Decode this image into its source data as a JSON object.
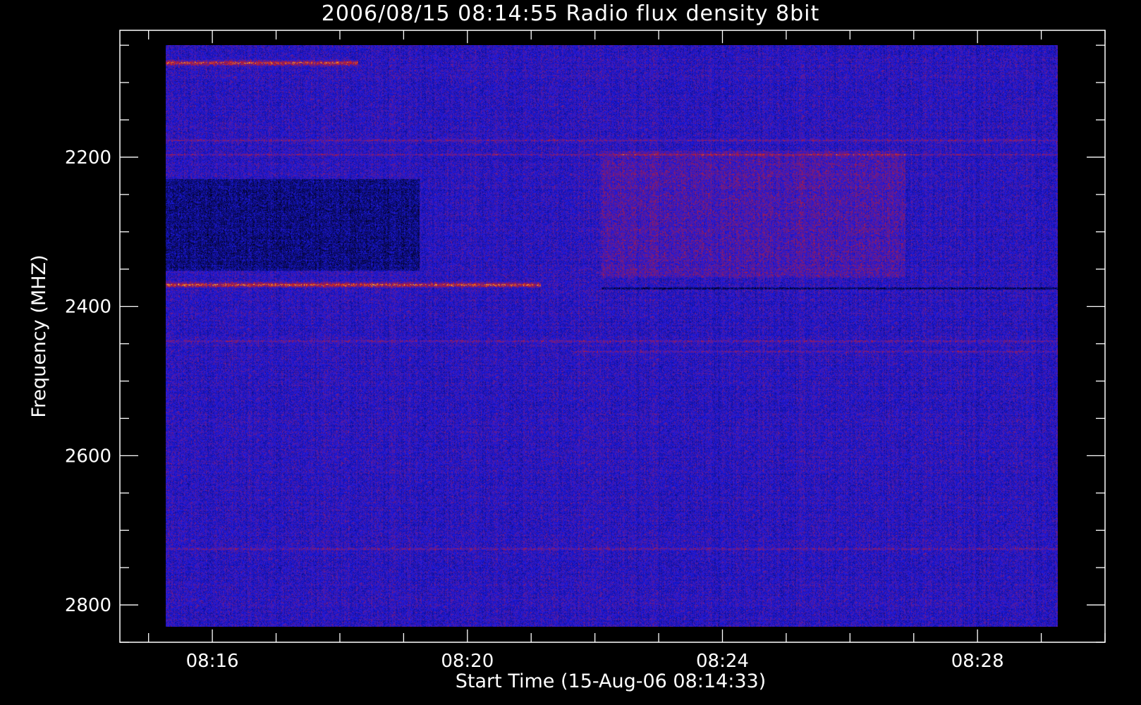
{
  "chart_data": {
    "type": "heatmap",
    "title": "2006/08/15 08:14:55 Radio flux density 8bit",
    "xlabel": "Start Time (15-Aug-06 08:14:33)",
    "ylabel": "Frequency (MHZ)",
    "x_range": [
      "08:14:33",
      "08:30:00"
    ],
    "x_major_ticks": [
      "08:16",
      "08:20",
      "08:24",
      "08:28"
    ],
    "y_range": [
      2850,
      2030
    ],
    "y_major_ticks": [
      2200,
      2400,
      2600,
      2800
    ],
    "data_time_span": [
      "08:15:20",
      "08:30:00"
    ],
    "data_freq_span": [
      2050,
      2875
    ],
    "colors": {
      "background": "#000000",
      "axes": "#ffffff",
      "low": "#000010",
      "mid": "#1a1ae6",
      "high": "#cc1a1a",
      "peak": "#ffcc33"
    },
    "features": [
      {
        "type": "band",
        "freq": 2390,
        "from": "08:15:20",
        "to": "08:21:30",
        "level": "high"
      },
      {
        "type": "band",
        "freq": 2395,
        "from": "08:22:30",
        "to": "08:30:00",
        "level": "low"
      },
      {
        "type": "band",
        "freq": 2075,
        "from": "08:15:20",
        "to": "08:18:30",
        "level": "high"
      },
      {
        "type": "band",
        "freq": 2185,
        "from": "08:15:20",
        "to": "08:30:00",
        "level": "elevated"
      },
      {
        "type": "band",
        "freq": 2205,
        "from": "08:15:20",
        "to": "08:30:00",
        "level": "elevated"
      },
      {
        "type": "band",
        "freq": 2470,
        "from": "08:15:20",
        "to": "08:30:00",
        "level": "elevated"
      },
      {
        "type": "band",
        "freq": 2485,
        "from": "08:22:00",
        "to": "08:30:00",
        "level": "elevated"
      },
      {
        "type": "band",
        "freq": 2765,
        "from": "08:15:20",
        "to": "08:30:00",
        "level": "elevated"
      },
      {
        "type": "region",
        "freq_from": 2200,
        "freq_to": 2380,
        "from": "08:22:30",
        "to": "08:27:30",
        "level": "elevated"
      },
      {
        "type": "region",
        "freq_from": 2240,
        "freq_to": 2370,
        "from": "08:15:20",
        "to": "08:19:30",
        "level": "low"
      }
    ]
  }
}
